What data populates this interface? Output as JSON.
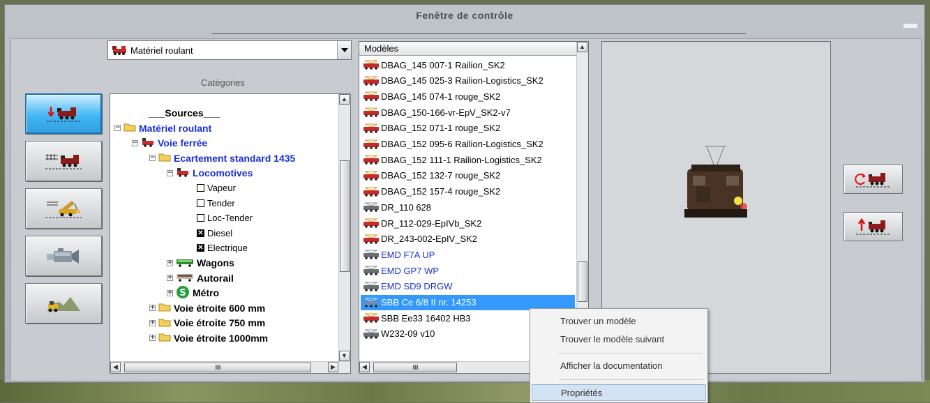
{
  "window": {
    "title": "Fenêtre de contrôle"
  },
  "combo": {
    "value": "Matériel roulant"
  },
  "categories_label": "Catégories",
  "tree": [
    {
      "label": "___Sources___",
      "bold": true,
      "blue": false,
      "depth": 1,
      "pm": "",
      "folder": false,
      "checkbox": ""
    },
    {
      "label": "Matériel roulant",
      "bold": true,
      "blue": true,
      "depth": 0,
      "pm": "−",
      "folder": true,
      "checkbox": ""
    },
    {
      "label": "Voie ferrée",
      "bold": true,
      "blue": true,
      "depth": 1,
      "pm": "−",
      "icon": "loco",
      "checkbox": ""
    },
    {
      "label": "Ecartement standard 1435",
      "bold": true,
      "blue": true,
      "depth": 2,
      "pm": "−",
      "folder": true,
      "checkbox": ""
    },
    {
      "label": "Locomotives",
      "bold": true,
      "blue": true,
      "depth": 3,
      "pm": "−",
      "icon": "loco",
      "checkbox": ""
    },
    {
      "label": "Vapeur",
      "bold": false,
      "blue": false,
      "depth": 4,
      "pm": "",
      "checkbox": "empty"
    },
    {
      "label": "Tender",
      "bold": false,
      "blue": false,
      "depth": 4,
      "pm": "",
      "checkbox": "empty"
    },
    {
      "label": "Loc-Tender",
      "bold": false,
      "blue": false,
      "depth": 4,
      "pm": "",
      "checkbox": "empty"
    },
    {
      "label": "Diesel",
      "bold": false,
      "blue": false,
      "depth": 4,
      "pm": "",
      "checkbox": "checked"
    },
    {
      "label": "Electrique",
      "bold": false,
      "blue": false,
      "depth": 4,
      "pm": "",
      "checkbox": "checked"
    },
    {
      "label": "Wagons",
      "bold": true,
      "blue": false,
      "depth": 3,
      "pm": "+",
      "icon": "wagon",
      "checkbox": ""
    },
    {
      "label": "Autorail",
      "bold": true,
      "blue": false,
      "depth": 3,
      "pm": "+",
      "icon": "railcar",
      "checkbox": ""
    },
    {
      "label": "Métro",
      "bold": true,
      "blue": false,
      "depth": 3,
      "pm": "+",
      "icon": "metro",
      "checkbox": ""
    },
    {
      "label": "Voie étroite 600 mm",
      "bold": true,
      "blue": false,
      "depth": 2,
      "pm": "+",
      "folder": true,
      "checkbox": ""
    },
    {
      "label": "Voie étroite 750 mm",
      "bold": true,
      "blue": false,
      "depth": 2,
      "pm": "+",
      "folder": true,
      "checkbox": ""
    },
    {
      "label": "Voie étroite 1000mm",
      "bold": true,
      "blue": false,
      "depth": 2,
      "pm": "+",
      "folder": true,
      "checkbox": ""
    }
  ],
  "models_header": "Modèles",
  "models": [
    {
      "name": "DBAG_145 007-1 Railion_SK2",
      "style": "normal",
      "icon": "red"
    },
    {
      "name": "DBAG_145 025-3 Railion-Logistics_SK2",
      "style": "normal",
      "icon": "red"
    },
    {
      "name": "DBAG_145 074-1 rouge_SK2",
      "style": "normal",
      "icon": "red"
    },
    {
      "name": "DBAG_150-166-vr-EpV_SK2-v7",
      "style": "normal",
      "icon": "red"
    },
    {
      "name": "DBAG_152 071-1 rouge_SK2",
      "style": "normal",
      "icon": "red"
    },
    {
      "name": "DBAG_152 095-6 Railion-Logistics_SK2",
      "style": "normal",
      "icon": "red"
    },
    {
      "name": "DBAG_152 111-1 Railion-Logistics_SK2",
      "style": "normal",
      "icon": "red"
    },
    {
      "name": "DBAG_152 132-7 rouge_SK2",
      "style": "normal",
      "icon": "red"
    },
    {
      "name": "DBAG_152 157-4 rouge_SK2",
      "style": "normal",
      "icon": "red"
    },
    {
      "name": "DR_110 628",
      "style": "normal",
      "icon": "grey"
    },
    {
      "name": "DR_112-029-EpIVb_SK2",
      "style": "normal",
      "icon": "red"
    },
    {
      "name": "DR_243-002-EpIV_SK2",
      "style": "normal",
      "icon": "red"
    },
    {
      "name": "EMD F7A UP",
      "style": "blue",
      "icon": "grey"
    },
    {
      "name": "EMD GP7 WP",
      "style": "blue",
      "icon": "grey"
    },
    {
      "name": "EMD SD9 DRGW",
      "style": "blue",
      "icon": "grey"
    },
    {
      "name": "SBB Ce 6/8 II nr. 14253",
      "style": "selected",
      "icon": "blue"
    },
    {
      "name": "SBB Ee33 16402 HB3",
      "style": "normal",
      "icon": "red"
    },
    {
      "name": "W232-09 v10",
      "style": "normal",
      "icon": "grey"
    }
  ],
  "context_menu": [
    {
      "label": "Trouver un modèle"
    },
    {
      "label": "Trouver le modèle suivant"
    },
    {
      "label": "Afficher la documentation"
    },
    {
      "label": "Propriétés"
    }
  ],
  "colors": {
    "accent": "#3399ff",
    "blue_text": "#1a2fd6",
    "active_button": "#43b7f4"
  }
}
